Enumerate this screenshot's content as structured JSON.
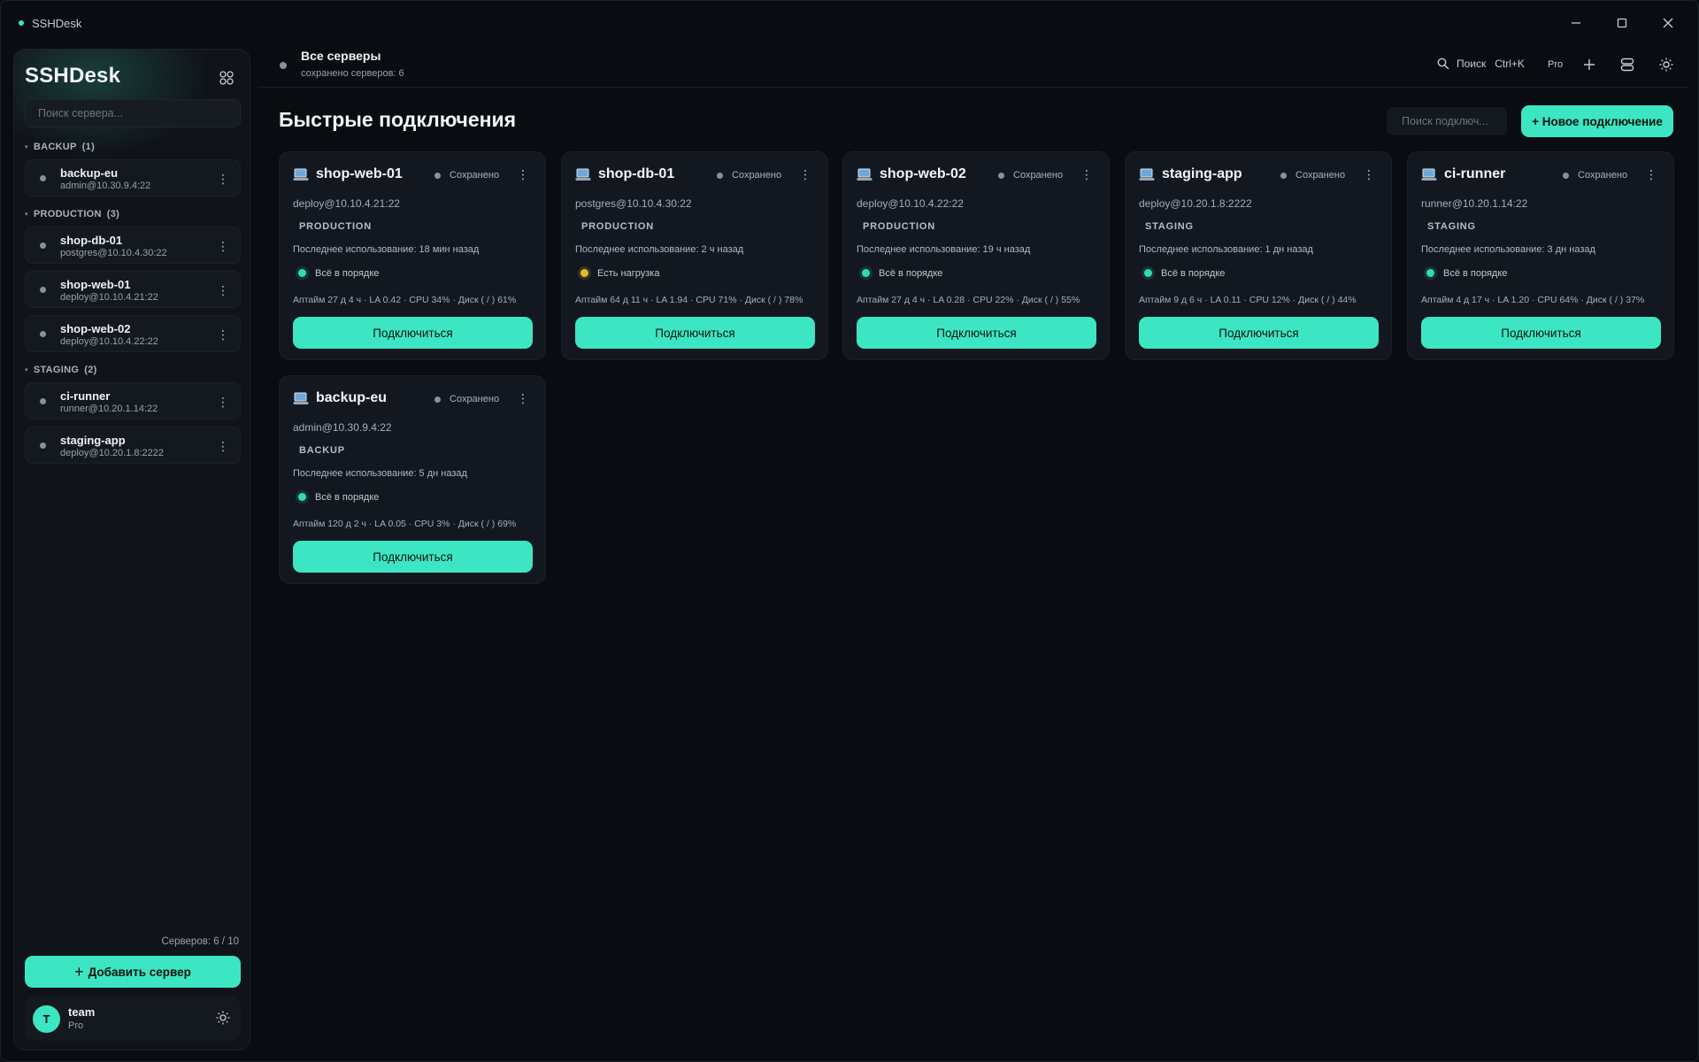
{
  "app": {
    "title": "SSHDesk"
  },
  "sidebar": {
    "brand": "SSHDesk",
    "search_placeholder": "Поиск сервера...",
    "groups": [
      {
        "name": "BACKUP",
        "count": "(1)",
        "items": [
          {
            "name": "backup-eu",
            "addr": "admin@10.30.9.4:22"
          }
        ]
      },
      {
        "name": "PRODUCTION",
        "count": "(3)",
        "items": [
          {
            "name": "shop-db-01",
            "addr": "postgres@10.10.4.30:22"
          },
          {
            "name": "shop-web-01",
            "addr": "deploy@10.10.4.21:22"
          },
          {
            "name": "shop-web-02",
            "addr": "deploy@10.10.4.22:22"
          }
        ]
      },
      {
        "name": "STAGING",
        "count": "(2)",
        "items": [
          {
            "name": "ci-runner",
            "addr": "runner@10.20.1.14:22"
          },
          {
            "name": "staging-app",
            "addr": "deploy@10.20.1.8:2222"
          }
        ]
      }
    ],
    "servers_count": "Серверов: 6 / 10",
    "add_server": "Добавить сервер",
    "user": {
      "initial": "T",
      "name": "team",
      "plan": "Pro"
    }
  },
  "header": {
    "title": "Все серверы",
    "subtitle": "сохранено серверов: 6",
    "search_label": "Поиск",
    "shortcut": "Ctrl+K",
    "plan": "Pro"
  },
  "main": {
    "title": "Быстрые подключения",
    "search_placeholder": "Поиск подключ...",
    "new_connection": "+ Новое подключение",
    "cards": [
      {
        "name": "shop-web-01",
        "status": "Сохранено",
        "addr": "deploy@10.10.4.21:22",
        "tag": "PRODUCTION",
        "last_used": "Последнее использование: 18 мин назад",
        "health": "Всё в порядке",
        "health_level": "ok",
        "stats": "Аптайм 27 д 4 ч · LA 0.42 · CPU 34% · Диск ( / ) 61%",
        "button": "Подключиться"
      },
      {
        "name": "shop-db-01",
        "status": "Сохранено",
        "addr": "postgres@10.10.4.30:22",
        "tag": "PRODUCTION",
        "last_used": "Последнее использование: 2 ч назад",
        "health": "Есть нагрузка",
        "health_level": "warn",
        "stats": "Аптайм 64 д 11 ч · LA 1.94 · CPU 71% · Диск ( / ) 78%",
        "button": "Подключиться"
      },
      {
        "name": "shop-web-02",
        "status": "Сохранено",
        "addr": "deploy@10.10.4.22:22",
        "tag": "PRODUCTION",
        "last_used": "Последнее использование: 19 ч назад",
        "health": "Всё в порядке",
        "health_level": "ok",
        "stats": "Аптайм 27 д 4 ч · LA 0.28 · CPU 22% · Диск ( / ) 55%",
        "button": "Подключиться"
      },
      {
        "name": "staging-app",
        "status": "Сохранено",
        "addr": "deploy@10.20.1.8:2222",
        "tag": "STAGING",
        "last_used": "Последнее использование: 1 дн назад",
        "health": "Всё в порядке",
        "health_level": "ok",
        "stats": "Аптайм 9 д 6 ч · LA 0.11 · CPU 12% · Диск ( / ) 44%",
        "button": "Подключиться"
      },
      {
        "name": "ci-runner",
        "status": "Сохранено",
        "addr": "runner@10.20.1.14:22",
        "tag": "STAGING",
        "last_used": "Последнее использование: 3 дн назад",
        "health": "Всё в порядке",
        "health_level": "ok",
        "stats": "Аптайм 4 д 17 ч · LA 1.20 · CPU 64% · Диск ( / ) 37%",
        "button": "Подключиться"
      },
      {
        "name": "backup-eu",
        "status": "Сохранено",
        "addr": "admin@10.30.9.4:22",
        "tag": "BACKUP",
        "last_used": "Последнее использование: 5 дн назад",
        "health": "Всё в порядке",
        "health_level": "ok",
        "stats": "Аптайм 120 д 2 ч · LA 0.05 · CPU 3% · Диск ( / ) 69%",
        "button": "Подключиться"
      }
    ]
  },
  "colors": {
    "accent": "#3de6c3",
    "ok": "#33d9b1",
    "warn": "#e6b82e",
    "background": "#090c11"
  },
  "icons": [
    "minimize-icon",
    "maximize-icon",
    "close-icon",
    "grid-icon",
    "search-icon",
    "plus-icon",
    "server-stack-icon",
    "sun-icon",
    "computer-icon",
    "kebab-icon"
  ]
}
